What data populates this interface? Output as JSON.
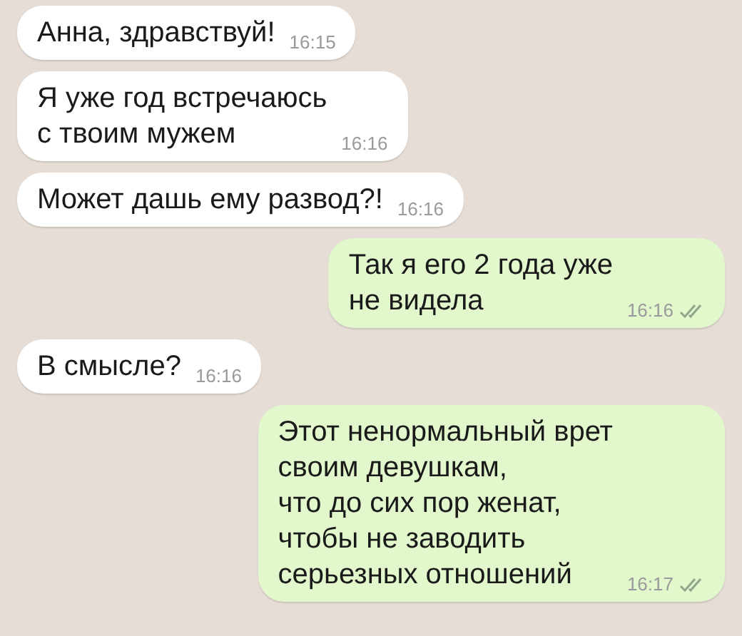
{
  "messages": [
    {
      "kind": "incoming",
      "text": "Анна, здравствуй!",
      "time": "16:15"
    },
    {
      "kind": "incoming",
      "text": "Я уже год встречаюсь\nс твоим мужем",
      "time": "16:16"
    },
    {
      "kind": "incoming",
      "text": "Может дашь ему развод?!",
      "time": "16:16"
    },
    {
      "kind": "outgoing",
      "text": "Так я его 2 года уже\nне видела",
      "time": "16:16"
    },
    {
      "kind": "incoming",
      "text": "В смысле?",
      "time": "16:16"
    },
    {
      "kind": "outgoing",
      "text": "Этот ненормальный врет\nсвоим девушкам,\nчто до сих пор женат,\nчтобы не заводить\nсерьезных отношений",
      "time": "16:17"
    }
  ]
}
